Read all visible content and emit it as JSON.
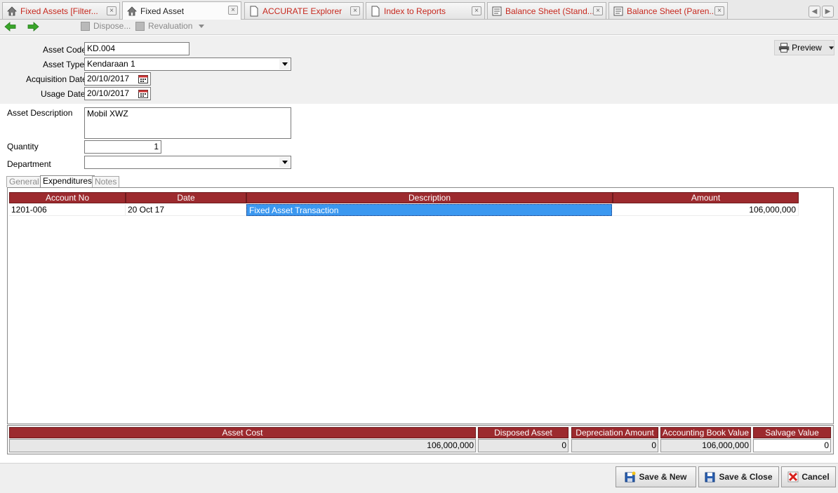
{
  "tabs": [
    {
      "label": "Fixed Assets [Filter...",
      "icon": "home-icon",
      "active": false
    },
    {
      "label": "Fixed Asset",
      "icon": "home-icon",
      "active": true
    },
    {
      "label": "ACCURATE Explorer",
      "icon": "document-icon",
      "active": false
    },
    {
      "label": "Index to Reports",
      "icon": "document-icon",
      "active": false
    },
    {
      "label": "Balance Sheet (Stand...",
      "icon": "report-icon",
      "active": false
    },
    {
      "label": "Balance Sheet (Paren...",
      "icon": "report-icon",
      "active": false
    }
  ],
  "tab_close_glyph": "×",
  "toolbar": {
    "dispose_label": "Dispose...",
    "revaluation_label": "Revaluation",
    "back_icon": "arrow-left-icon",
    "forward_icon": "arrow-right-icon"
  },
  "preview_label": "Preview",
  "form": {
    "asset_code_label": "Asset Code",
    "asset_code_value": "KD.004",
    "asset_type_label": "Asset Type",
    "asset_type_value": "Kendaraan 1",
    "acquisition_date_label": "Acquisition Date",
    "acquisition_date_value": "20/10/2017",
    "usage_date_label": "Usage Date",
    "usage_date_value": "20/10/2017",
    "asset_description_label": "Asset Description",
    "asset_description_value": "Mobil XWZ",
    "quantity_label": "Quantity",
    "quantity_value": "1",
    "department_label": "Department",
    "department_value": ""
  },
  "inner_tabs": [
    "General",
    "Expenditures",
    "Notes"
  ],
  "grid": {
    "columns": [
      "Account No",
      "Date",
      "Description",
      "Amount"
    ],
    "rows": [
      {
        "account_no": "1201-006",
        "date": "20 Oct 17",
        "description": "Fixed Asset Transaction",
        "amount": "106,000,000"
      }
    ]
  },
  "totals": {
    "asset_cost_label": "Asset Cost",
    "asset_cost_value": "106,000,000",
    "disposed_asset_label": "Disposed Asset",
    "disposed_asset_value": "0",
    "depreciation_amount_label": "Depreciation Amount",
    "depreciation_amount_value": "0",
    "accounting_book_value_label": "Accounting Book Value",
    "accounting_book_value_value": "106,000,000",
    "salvage_value_label": "Salvage Value",
    "salvage_value_value": "0"
  },
  "buttons": {
    "save_new_label": "Save & New",
    "save_close_label": "Save & Close",
    "cancel_label": "Cancel"
  },
  "colors": {
    "header_red": "#9c2a2e",
    "tab_text_red": "#c6281e",
    "selection_blue": "#3b98f0",
    "nav_green": "#3aa52a"
  }
}
